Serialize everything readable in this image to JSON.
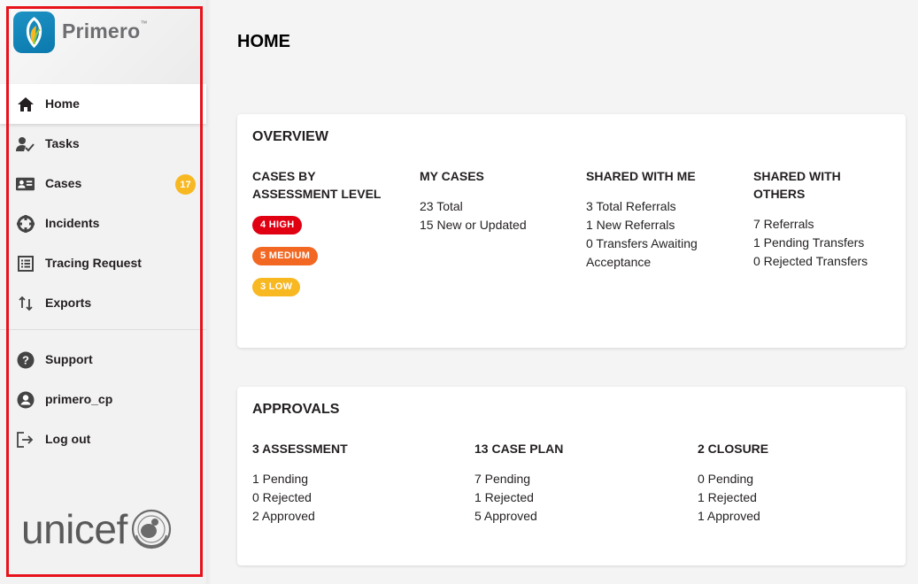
{
  "app": {
    "name": "Primero",
    "trademark": "™",
    "partner": "unicef"
  },
  "sidebar": {
    "items": [
      {
        "label": "Home",
        "icon": "home-icon",
        "active": true
      },
      {
        "label": "Tasks",
        "icon": "tasks-icon"
      },
      {
        "label": "Cases",
        "icon": "cases-icon",
        "badge": "17"
      },
      {
        "label": "Incidents",
        "icon": "incidents-icon"
      },
      {
        "label": "Tracing Request",
        "icon": "tracing-request-icon"
      },
      {
        "label": "Exports",
        "icon": "exports-icon"
      }
    ],
    "footer_items": [
      {
        "label": "Support",
        "icon": "help-icon"
      },
      {
        "label": "primero_cp",
        "icon": "account-icon"
      },
      {
        "label": "Log out",
        "icon": "logout-icon"
      }
    ]
  },
  "page": {
    "title": "HOME"
  },
  "overview": {
    "title": "OVERVIEW",
    "assessment": {
      "heading_line1": "CASES BY",
      "heading_line2": "ASSESSMENT LEVEL",
      "high": "4 HIGH",
      "medium": "5 MEDIUM",
      "low": "3 LOW"
    },
    "my_cases": {
      "heading": "MY CASES",
      "total": "23 Total",
      "new_updated": "15 New or Updated"
    },
    "shared_with_me": {
      "heading": "SHARED WITH ME",
      "total_referrals": "3 Total Referrals",
      "new_referrals": "1 New Referrals",
      "transfers_awaiting_line1": "0 Transfers Awaiting",
      "transfers_awaiting_line2": "Acceptance"
    },
    "shared_with_others": {
      "heading_line1": "SHARED WITH",
      "heading_line2": "OTHERS",
      "referrals": "7 Referrals",
      "pending_transfers": "1 Pending Transfers",
      "rejected_transfers": "0 Rejected Transfers"
    }
  },
  "approvals": {
    "title": "APPROVALS",
    "columns": [
      {
        "heading": "3 ASSESSMENT",
        "pending": "1 Pending",
        "rejected": "0 Rejected",
        "approved": "2 Approved"
      },
      {
        "heading": "13 CASE PLAN",
        "pending": "7 Pending",
        "rejected": "1 Rejected",
        "approved": "5 Approved"
      },
      {
        "heading": "2 CLOSURE",
        "pending": "0 Pending",
        "rejected": "1 Rejected",
        "approved": "1 Approved"
      }
    ]
  },
  "colors": {
    "brand_blue": "#1d92c4",
    "high": "#e00012",
    "medium": "#f26722",
    "low": "#f8b822",
    "badge": "#f8b822",
    "highlight": "#e8121b"
  }
}
